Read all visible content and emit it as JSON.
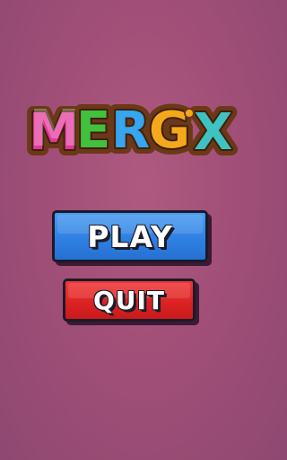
{
  "logo": {
    "letters": [
      {
        "char": "M",
        "color": "#e2379a"
      },
      {
        "char": "E",
        "color": "#41c13d"
      },
      {
        "char": "R",
        "color": "#35a6ef"
      },
      {
        "char": "G",
        "color": "#f4a91b"
      },
      {
        "char": "X",
        "color": "#3ec2c2"
      }
    ],
    "dot_color": "#f4a91b",
    "outline_color": "#6b3818"
  },
  "menu": {
    "play_label": "PLAY",
    "play_color": "#2f80e3",
    "quit_label": "QUIT",
    "quit_color": "#dd2323"
  },
  "background_color": "#a14f78"
}
